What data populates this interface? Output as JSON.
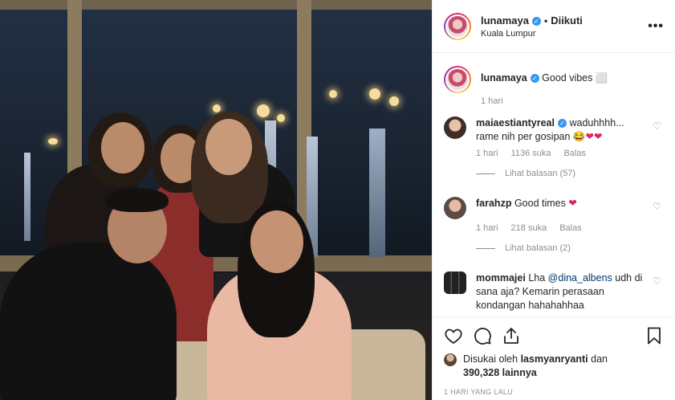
{
  "post": {
    "photo_alt": "",
    "author": {
      "username": "lunamaya",
      "follow_status": "Diikuti",
      "location": "Kuala Lumpur"
    },
    "more_icon": "more-horizontal-icon"
  },
  "caption": {
    "username": "lunamaya",
    "text": "Good vibes ⬜",
    "time": "1 hari"
  },
  "comments": [
    {
      "username": "maiaestiantyreal",
      "verified": true,
      "text": "waduhhhh... rame nih per gosipan 😂❤❤",
      "time": "1 hari",
      "likes": "1136 suka",
      "reply_label": "Balas",
      "view_replies": "Lihat balasan (57)"
    },
    {
      "username": "farahzp",
      "verified": false,
      "text": "Good times ❤",
      "time": "1 hari",
      "likes": "218 suka",
      "reply_label": "Balas",
      "view_replies": "Lihat balasan (2)"
    },
    {
      "username": "mommajei",
      "verified": false,
      "text_prefix": "Lha ",
      "mention": "@dina_albens",
      "text_suffix": " udh di sana aja? Kemarin perasaan kondangan hahahahhaa"
    }
  ],
  "actions": {
    "like_icon": "heart-icon",
    "comment_icon": "comment-icon",
    "share_icon": "share-icon",
    "save_icon": "bookmark-icon"
  },
  "likes": {
    "prefix": "Disukai oleh ",
    "user": "lasmyanryanti",
    "middle": " dan ",
    "count": "390,328",
    "suffix": " lainnya"
  },
  "timestamp": "1 HARI YANG LALU",
  "colors": {
    "accent": "#3897f0",
    "heart": "#e0245e",
    "muted": "#8e8e8e"
  }
}
